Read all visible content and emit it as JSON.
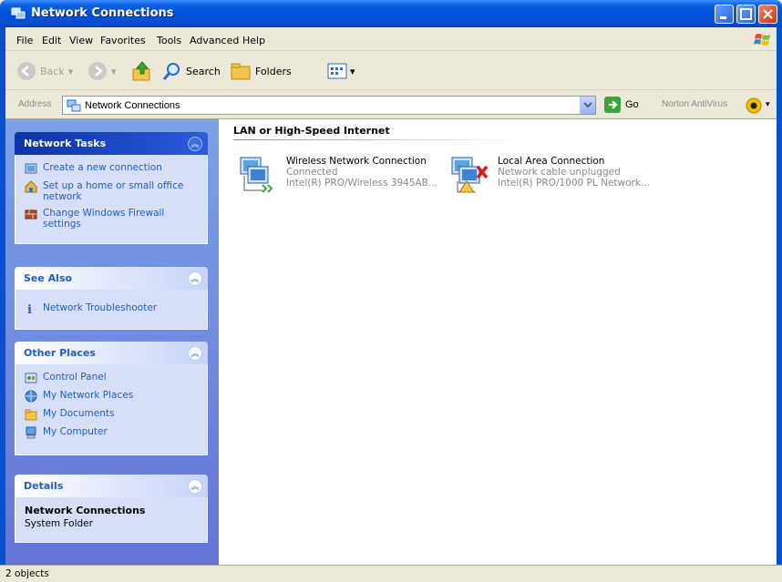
{
  "window": {
    "title": "Network Connections",
    "colors": {
      "titlebar": "#0050d8",
      "taskpane": "#6f8ee0",
      "link": "#215dc6"
    }
  },
  "menu": [
    "File",
    "Edit",
    "View",
    "Favorites",
    "Tools",
    "Advanced",
    "Help"
  ],
  "toolbar": {
    "back": "Back",
    "search": "Search",
    "folders": "Folders"
  },
  "address": {
    "label": "Address",
    "value": "Network Connections",
    "go": "Go",
    "norton": "Norton AntiVirus"
  },
  "taskpane": {
    "network_tasks": {
      "title": "Network Tasks",
      "items": [
        {
          "label": "Create a new connection",
          "icon": "new-connection-icon"
        },
        {
          "label": "Set up a home or small office network",
          "icon": "home-network-icon"
        },
        {
          "label": "Change Windows Firewall settings",
          "icon": "firewall-icon"
        }
      ]
    },
    "see_also": {
      "title": "See Also",
      "items": [
        {
          "label": "Network Troubleshooter",
          "icon": "info-icon"
        }
      ]
    },
    "other_places": {
      "title": "Other Places",
      "items": [
        {
          "label": "Control Panel",
          "icon": "control-panel-icon"
        },
        {
          "label": "My Network Places",
          "icon": "network-places-icon"
        },
        {
          "label": "My Documents",
          "icon": "folder-icon"
        },
        {
          "label": "My Computer",
          "icon": "computer-icon"
        }
      ]
    },
    "details": {
      "title": "Details",
      "name": "Network Connections",
      "type": "System Folder"
    }
  },
  "content": {
    "group": "LAN or High-Speed Internet",
    "connections": [
      {
        "name": "Wireless Network Connection",
        "status": "Connected",
        "device": "Intel(R) PRO/Wireless 3945AB...",
        "icon": "wireless-connection-icon"
      },
      {
        "name": "Local Area Connection",
        "status": "Network cable unplugged",
        "device": "Intel(R) PRO/1000 PL Network...",
        "icon": "lan-disconnected-icon"
      }
    ]
  },
  "statusbar": {
    "text": "2 objects"
  }
}
